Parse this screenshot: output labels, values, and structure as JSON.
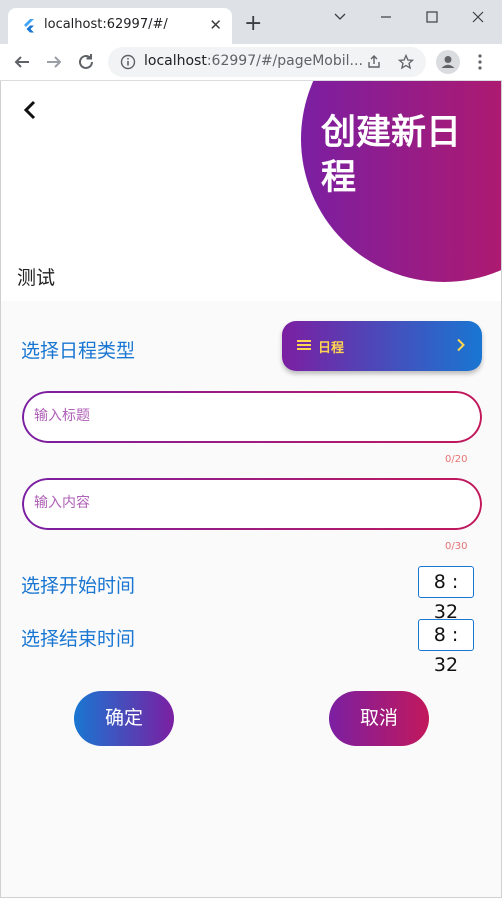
{
  "browser": {
    "tab_title": "localhost:62997/#/",
    "url_host": "localhost",
    "url_rest": ":62997/#/pageMobil...",
    "icons": [
      "flutter-icon",
      "close-icon",
      "plus-icon",
      "minimize-icon",
      "maximize-icon",
      "close-window-icon",
      "back-arrow-icon",
      "forward-arrow-icon",
      "reload-icon",
      "info-icon",
      "share-icon",
      "star-icon",
      "profile-icon",
      "menu-icon"
    ]
  },
  "header": {
    "title": "创建新日程",
    "subtitle": "测试"
  },
  "schedule_type": {
    "label": "选择日程类型",
    "selected": "日程"
  },
  "title_field": {
    "placeholder": "输入标题",
    "counter": "0/20"
  },
  "content_field": {
    "placeholder": "输入内容",
    "counter": "0/30"
  },
  "start_time": {
    "label": "选择开始时间",
    "value": "8 : 32"
  },
  "end_time": {
    "label": "选择结束时间",
    "value": "8 : 32"
  },
  "actions": {
    "confirm": "确定",
    "cancel": "取消"
  },
  "colors": {
    "purple": "#7b1fa2",
    "magenta": "#c2185b",
    "blue": "#1976d2",
    "yellow": "#ffd54f"
  }
}
